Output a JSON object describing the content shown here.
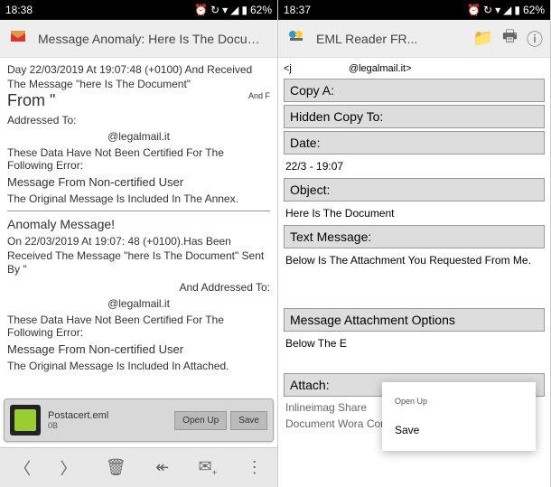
{
  "left": {
    "status": {
      "time": "18:38",
      "battery": "62%"
    },
    "header": {
      "title": "Message Anomaly: Here Is The Document"
    },
    "body": {
      "line1": "Day 22/03/2019 At 19:07:48 (+0100) And Received The Message \"here Is The Document\"",
      "from": "From \"",
      "andf": "And F",
      "addressed": "Addressed To:",
      "email": "@legalmail.it",
      "cert": "These Data Have Not Been Certified For The Following Error:",
      "noncert": "Message From Non-certified User",
      "annex": "The Original Message Is Included In The Annex.",
      "anomaly": "Anomaly Message!",
      "on": "On 22/03/2019 At 19:07: 48 (+0100).Has Been Received The Message \"here Is The Document\" Sent By \"",
      "addr2": "And Addressed To:",
      "email2": "@legalmail.it",
      "cert2": "These Data Have Not Been Certified For The Following Error:",
      "noncert2": "Message From Non-certified User",
      "attached": "The Original Message Is Included In Attached."
    },
    "attachment": {
      "name": "Postacert.eml",
      "size": "0B",
      "open": "Open Up",
      "save": "Save"
    }
  },
  "right": {
    "status": {
      "time": "18:37",
      "battery": "62%"
    },
    "header": {
      "title": "EML Reader FR..."
    },
    "body": {
      "emailprefix": "<j",
      "email": "@legalmail.it>",
      "copy": "Copy A:",
      "hidden": "Hidden Copy To:",
      "date": "Date:",
      "dateval": "22/3 - 19:07",
      "object": "Object:",
      "objectval": "Here Is The Document",
      "textmsg": "Text Message:",
      "below": "Below Is The Attachment You Requested From Me.",
      "msgattach": "Message Attachment Options",
      "belowe": "Below The E",
      "attach": "Attach:",
      "inline": "Inlineimag Share",
      "doc": "Document Wora Conarviso.cocx"
    },
    "menu": {
      "open": "Open Up",
      "save": "Save"
    }
  }
}
